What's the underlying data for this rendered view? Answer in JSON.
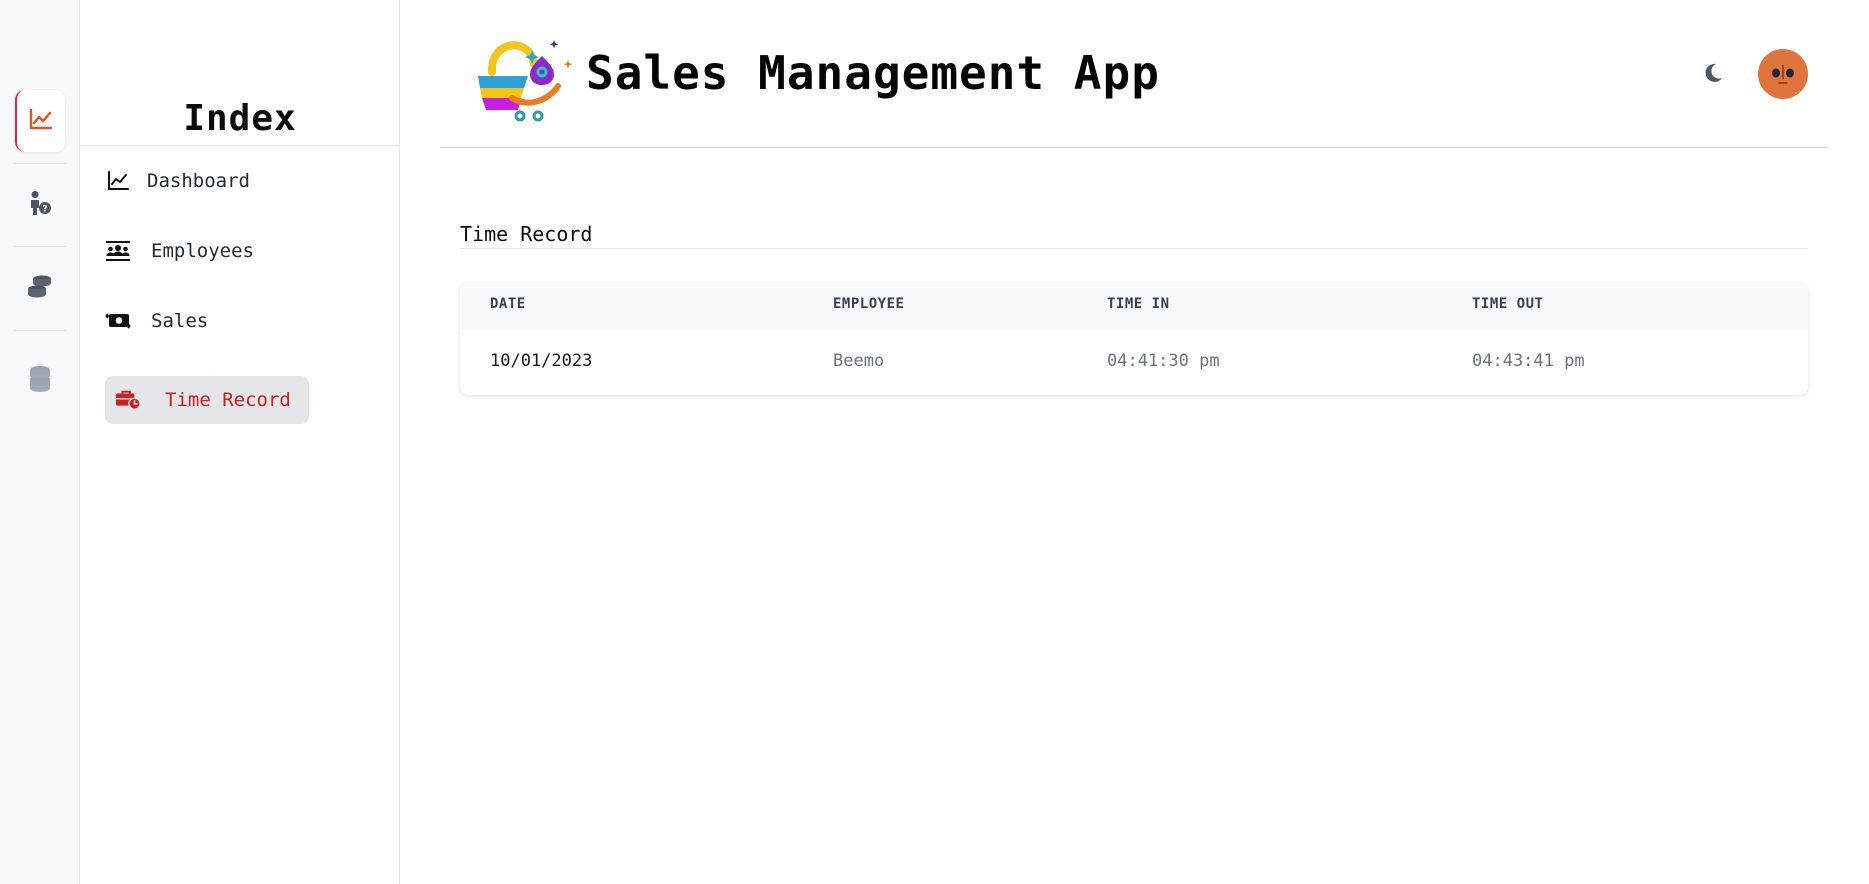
{
  "app": {
    "title": "Sales Management App"
  },
  "rail": {
    "items": [
      {
        "name": "chart-line-icon",
        "active": true
      },
      {
        "name": "person-question-icon",
        "active": false
      },
      {
        "name": "coins-icon",
        "active": false
      },
      {
        "name": "database-icon",
        "active": false
      }
    ]
  },
  "sidebar": {
    "title": "Index",
    "items": [
      {
        "label": "Dashboard",
        "icon": "chart-line-icon"
      },
      {
        "label": "Employees",
        "icon": "people-group-icon"
      },
      {
        "label": "Sales",
        "icon": "money-bill-transfer-icon"
      },
      {
        "label": "Time Record",
        "icon": "briefcase-clock-icon",
        "active": true
      }
    ]
  },
  "header": {
    "theme_icon": "moon-icon",
    "avatar_icon": "avatar-face-icon"
  },
  "main": {
    "section_title": "Time Record",
    "table": {
      "columns": [
        "DATE",
        "EMPLOYEE",
        "TIME IN",
        "TIME OUT"
      ],
      "rows": [
        [
          "10/01/2023",
          "Beemo",
          "04:41:30 pm",
          "04:43:41 pm"
        ]
      ]
    }
  },
  "colors": {
    "accent": "#c8201d",
    "rail_active_border": "#dc2655",
    "avatar_bg": "#e0743f",
    "active_nav_bg": "#e5e6ea"
  }
}
